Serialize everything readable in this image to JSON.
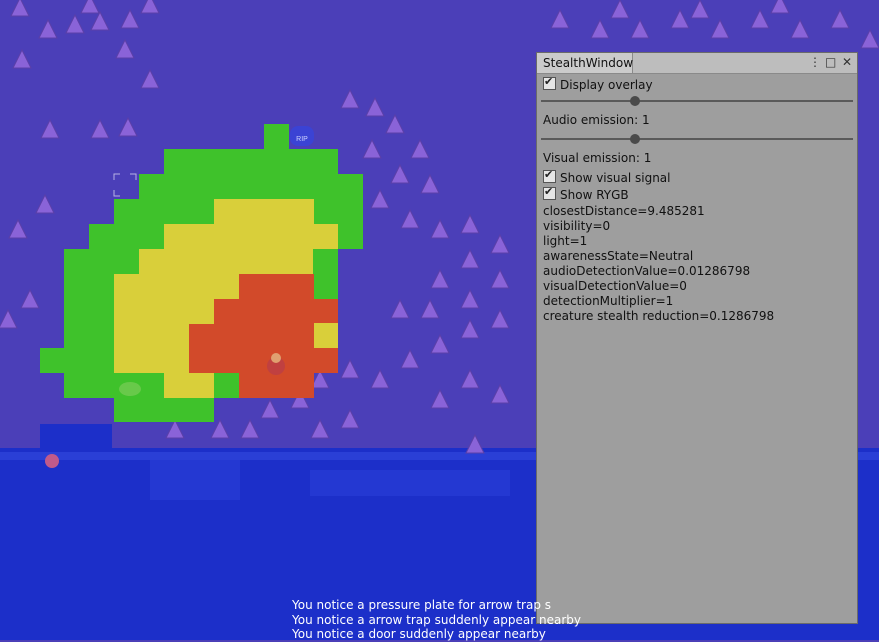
{
  "window": {
    "title": "StealthWindow",
    "menu_icon": "kebab-menu-icon",
    "maximize_icon": "maximize-icon",
    "close_icon": "close-icon",
    "display_overlay": {
      "label": "Display overlay",
      "checked": true
    },
    "audio_slider": {
      "value": 0.3
    },
    "audio_emission": "Audio emission: 1",
    "visual_slider": {
      "value": 0.3
    },
    "visual_emission": "Visual emission: 1",
    "show_visual_signal": {
      "label": "Show visual signal",
      "checked": true
    },
    "show_rygb": {
      "label": "Show RYGB",
      "checked": true
    },
    "stats": [
      "closestDistance=9.485281",
      "visibility=0",
      "light=1",
      "awarenessState=Neutral",
      "audioDetectionValue=0.01286798",
      "visualDetectionValue=0",
      "detectionMultiplier=1",
      "creature stealth reduction=0.1286798"
    ]
  },
  "map": {
    "tombstone_label": "RIP",
    "overlay_colors": {
      "green": "#3fc22b",
      "yellow": "#d9cf3a",
      "red": "#d24a2a"
    },
    "ground_color": "#4b3fb8",
    "water_color": "#1c2fc9"
  },
  "log": [
    "You notice a pressure plate for arrow trap s",
    "You notice a arrow trap suddenly appear nearby",
    "You notice a door suddenly appear nearby"
  ]
}
